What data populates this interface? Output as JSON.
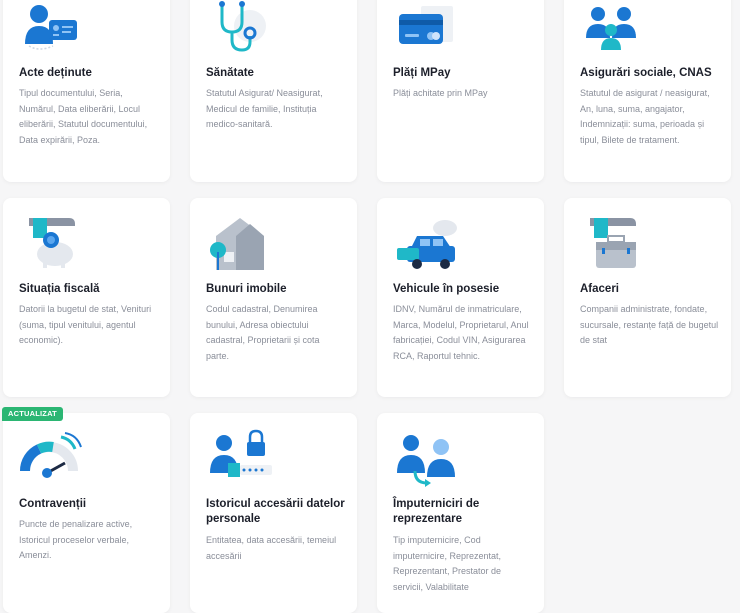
{
  "badge": "ACTUALIZAT",
  "colors": {
    "primary": "#1b77d2",
    "teal": "#1fb8c8",
    "badge": "#2bb673"
  },
  "cards": [
    {
      "icon": "id-card-icon",
      "title": "Acte deținute",
      "desc": "Tipul documentului, Seria, Numărul, Data eliberării, Locul eliberării, Statutul documentului, Data expirării, Poza."
    },
    {
      "icon": "stethoscope-icon",
      "title": "Sănătate",
      "desc": "Statutul Asigurat/ Neasigurat, Medicul de familie, Instituția medico-sanitară."
    },
    {
      "icon": "credit-card-icon",
      "title": "Plăți MPay",
      "desc": "Plăți achitate prin MPay"
    },
    {
      "icon": "family-icon",
      "title": "Asigurări sociale, CNAS",
      "desc": "Statutul de asigurat / neasigurat, An, luna, suma, angajator, Indemnizații: suma, perioada și tipul, Bilete de tratament."
    },
    {
      "icon": "piggy-bank-icon",
      "title": "Situația fiscală",
      "desc": "Datorii la bugetul de stat, Venituri (suma, tipul venitului, agentul economic)."
    },
    {
      "icon": "house-icon",
      "title": "Bunuri imobile",
      "desc": "Codul cadastral, Denumirea bunului, Adresa obiectului cadastral, Proprietarii și cota parte."
    },
    {
      "icon": "car-icon",
      "title": "Vehicule în posesie",
      "desc": "IDNV, Numărul de inmatriculare, Marca, Modelul, Proprietarul, Anul fabricației, Codul VIN, Asigurarea RCA, Raportul tehnic."
    },
    {
      "icon": "briefcase-icon",
      "title": "Afaceri",
      "desc": "Companii administrate, fondate, sucursale, restanțe față de bugetul de stat"
    },
    {
      "icon": "speedometer-icon",
      "title": "Contravenții",
      "desc": "Puncte de penalizare active, Istoricul proceselor verbale, Amenzi."
    },
    {
      "icon": "user-lock-icon",
      "title": "Istoricul accesării datelor personale",
      "desc": "Entitatea, data accesării, temeiul accesării"
    },
    {
      "icon": "representatives-icon",
      "title": "Împuterniciri de reprezentare",
      "desc": "Tip imputernicire, Cod imputernicire, Reprezentat, Reprezentant, Prestator de servicii, Valabilitate"
    }
  ]
}
